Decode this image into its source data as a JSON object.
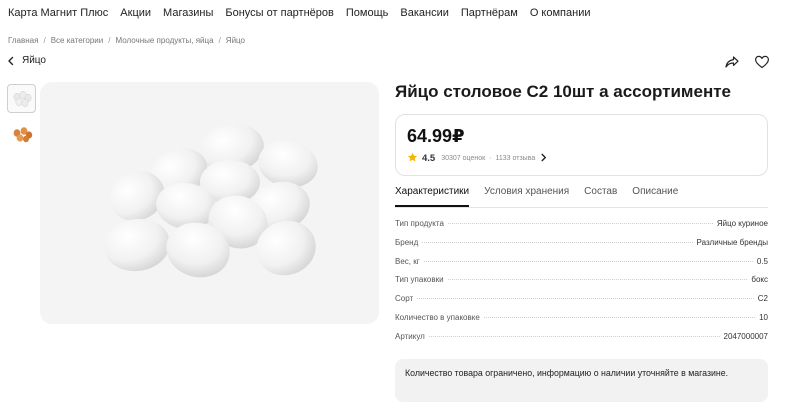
{
  "nav": {
    "items": [
      "Карта Магнит Плюс",
      "Акции",
      "Магазины",
      "Бонусы от партнёров",
      "Помощь",
      "Вакансии",
      "Партнёрам",
      "О компании"
    ]
  },
  "breadcrumb": [
    "Главная",
    "Все категории",
    "Молочные продукты, яйца",
    "Яйцо"
  ],
  "back": {
    "label": "Яйцо"
  },
  "product": {
    "title": "Яйцо столовое С2 10шт а ассортименте",
    "price": "64.99₽",
    "rating": "4.5",
    "ratings_count": "30307 оценок",
    "reviews_count": "1133 отзыва"
  },
  "tabs": [
    "Характеристики",
    "Условия хранения",
    "Состав",
    "Описание"
  ],
  "specs": [
    {
      "label": "Тип продукта",
      "value": "Яйцо куриное"
    },
    {
      "label": "Бренд",
      "value": "Различные бренды"
    },
    {
      "label": "Вес, кг",
      "value": "0.5"
    },
    {
      "label": "Тип упаковки",
      "value": "бокс"
    },
    {
      "label": "Сорт",
      "value": "С2"
    },
    {
      "label": "Количество в упаковке",
      "value": "10"
    },
    {
      "label": "Артикул",
      "value": "2047000007"
    }
  ],
  "notice": "Количество товара ограничено, информацию о наличии уточняйте в магазине.",
  "colors": {
    "star": "#f5b400",
    "text": "#1f1f1f",
    "muted": "#8a8a8a",
    "image_bg": "#f4f4f4"
  },
  "icons": [
    "chevron-left-icon",
    "share-icon",
    "heart-icon",
    "star-icon",
    "chevron-right-icon"
  ]
}
